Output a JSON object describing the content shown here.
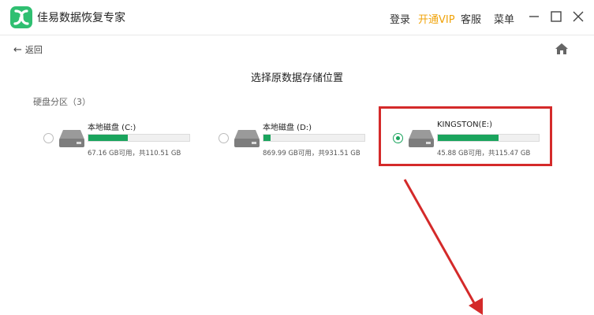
{
  "app": {
    "title": "佳易数据恢复专家"
  },
  "menu": {
    "login": "登录",
    "vip": "开通VIP",
    "service": "客服",
    "menu": "菜单"
  },
  "nav": {
    "back": "返回"
  },
  "page": {
    "title": "选择原数据存储位置",
    "section": "硬盘分区（3）"
  },
  "drives": [
    {
      "name": "本地磁盘 (C:)",
      "capacity": "67.16 GB可用，共110.51 GB",
      "used_fraction": 0.39,
      "selected": false
    },
    {
      "name": "本地磁盘 (D:)",
      "capacity": "869.99 GB可用，共931.51 GB",
      "used_fraction": 0.07,
      "selected": false
    },
    {
      "name": "KINGSTON(E:)",
      "capacity": "45.88 GB可用，共115.47 GB",
      "used_fraction": 0.6,
      "selected": true
    }
  ],
  "colors": {
    "accent": "#1aa45d",
    "vip": "#f0a30a",
    "highlight": "#d42a2a"
  }
}
